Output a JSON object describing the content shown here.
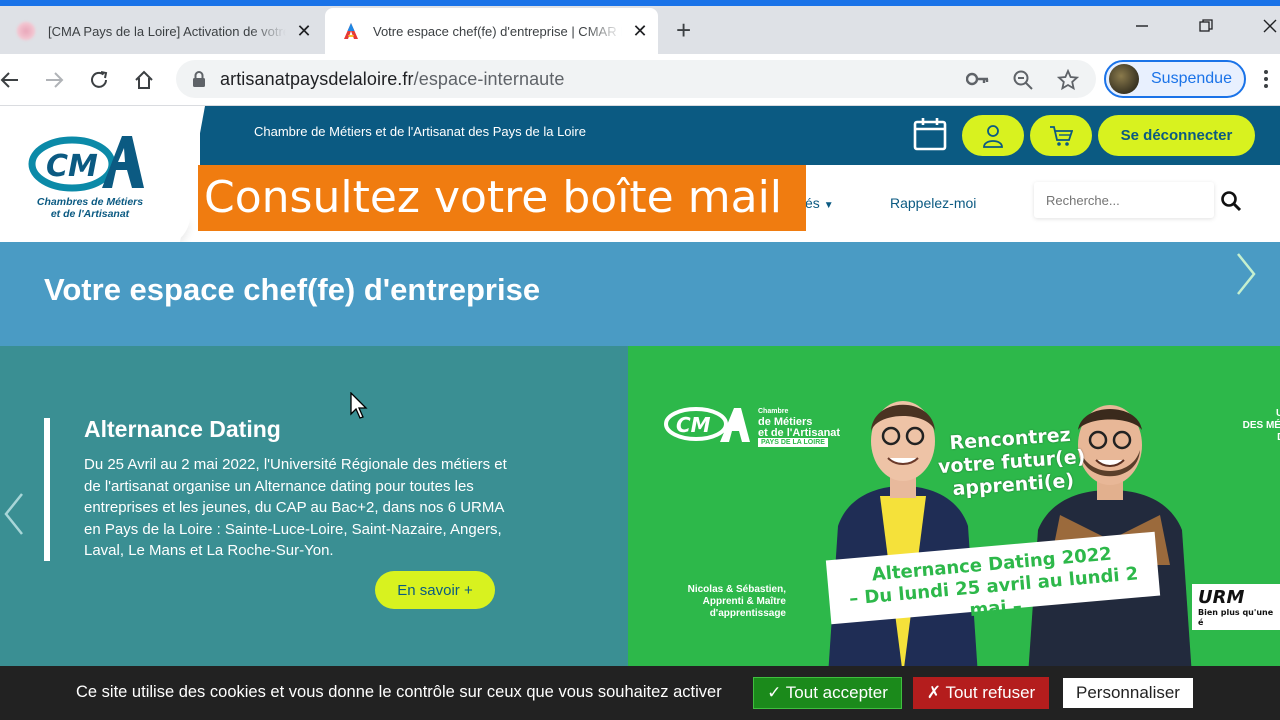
{
  "browser": {
    "tabs": [
      {
        "title": "[CMA Pays de la Loire] Activation de votre compte",
        "active": false
      },
      {
        "title": "Votre espace chef(fe) d'entreprise | CMAR Pays de la Loire",
        "active": true
      }
    ],
    "url_host": "artisanatpaysdelaloire.fr",
    "url_path": "/espace-internaute",
    "profile_label": "Suspendue",
    "accent_color": "#1a73e8"
  },
  "site": {
    "logo_line1": "Chambres de Métiers",
    "logo_line2": "et de l'Artisanat",
    "chambre_label": "Chambre de Métiers et de l'Artisanat des Pays de la Loire",
    "logout_label": "Se déconnecter",
    "nav_partial": "és",
    "nav_rappel": "Rappelez-moi",
    "search_placeholder": "Recherche...",
    "overlay_banner": "Consultez votre boîte mail",
    "page_title": "Votre espace chef(fe) d'entreprise",
    "colors": {
      "dark_blue": "#0b5a82",
      "lime": "#d8f21f",
      "title_band": "#4a9bc4",
      "slide_teal": "#3a8f93",
      "slide_green": "#2db84a",
      "banner_orange": "#f07c10"
    }
  },
  "slide": {
    "title": "Alternance Dating",
    "text": "Du 25 Avril au 2 mai 2022, l'Université Régionale des métiers et de l'artisanat organise un Alternance dating pour toutes les entreprises et les jeunes, du CAP au Bac+2, dans nos 6 URMA en Pays de la Loire : Sainte-Luce-Loire, Saint-Nazaire, Angers, Laval, Le Mans et La Roche-Sur-Yon.",
    "button": "En savoir +",
    "ad": {
      "logo_l1": "Chambre",
      "logo_l2": "de Métiers",
      "logo_l3": "et de l'Artisanat",
      "pays": "PAYS DE LA LOIRE",
      "headline_1": "Rencontrez",
      "headline_2": "votre futur(e)",
      "headline_3": "apprenti(e)",
      "univ_1": "UNIVERSITÉ",
      "univ_2": "DES MÉTIERS DE L",
      "univ_3": "DES PAYS D",
      "ribbon_1": "Alternance Dating 2022",
      "ribbon_2": "– Du lundi 25 avril au lundi 2 mai –",
      "caption_1": "Nicolas & Sébastien,",
      "caption_2": "Apprenti & Maître",
      "caption_3": "d'apprentissage",
      "urma": "URM",
      "urma_sub": "Bien plus qu'une é"
    }
  },
  "cookies": {
    "text": "Ce site utilise des cookies et vous donne le contrôle sur ceux que vous souhaitez activer",
    "accept": "✓ Tout accepter",
    "refuse": "✗ Tout refuser",
    "customize": "Personnaliser"
  }
}
